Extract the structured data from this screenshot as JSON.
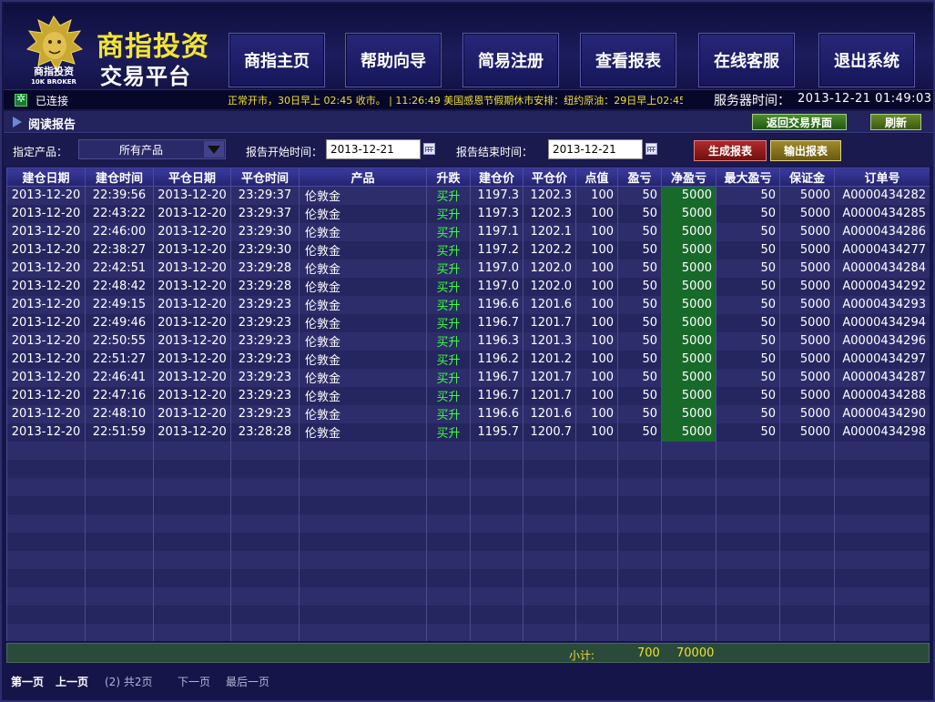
{
  "header": {
    "logo_text": "商指投资",
    "logo_sub": "10K BROKER",
    "brand_title": "商指投资",
    "brand_subtitle": "交易平台",
    "nav": [
      "商指主页",
      "帮助向导",
      "简易注册",
      "查看报表",
      "在线客服",
      "退出系统"
    ]
  },
  "status": {
    "connection": "已连接",
    "ticker": "正常开市，30日早上 02:45 收市。 | 11:26:49 美国感恩节假期休市安排：纽约原油：29日早上02:45收市，",
    "server_label": "服务器时间：",
    "server_time": "2013-12-21 01:49:03"
  },
  "section": {
    "title": "阅读报告",
    "back_label": "返回交易界面",
    "refresh_label": "刷新"
  },
  "filters": {
    "product_label": "指定产品：",
    "product_value": "所有产品",
    "start_label": "报告开始时间：",
    "start_value": "2013-12-21",
    "end_label": "报告结束时间：",
    "end_value": "2013-12-21",
    "generate_label": "生成报表",
    "export_label": "输出报表"
  },
  "table": {
    "columns": [
      "建仓日期",
      "建仓时间",
      "平仓日期",
      "平仓时间",
      "产品",
      "升跌",
      "建仓价",
      "平仓价",
      "点值",
      "盈亏",
      "净盈亏",
      "最大盈亏",
      "保证金",
      "订单号"
    ],
    "rows": [
      [
        "2013-12-20",
        "22:39:56",
        "2013-12-20",
        "23:29:37",
        "伦敦金",
        "买升",
        "1197.3",
        "1202.3",
        "100",
        "50",
        "5000",
        "50",
        "5000",
        "A0000434282"
      ],
      [
        "2013-12-20",
        "22:43:22",
        "2013-12-20",
        "23:29:37",
        "伦敦金",
        "买升",
        "1197.3",
        "1202.3",
        "100",
        "50",
        "5000",
        "50",
        "5000",
        "A0000434285"
      ],
      [
        "2013-12-20",
        "22:46:00",
        "2013-12-20",
        "23:29:30",
        "伦敦金",
        "买升",
        "1197.1",
        "1202.1",
        "100",
        "50",
        "5000",
        "50",
        "5000",
        "A0000434286"
      ],
      [
        "2013-12-20",
        "22:38:27",
        "2013-12-20",
        "23:29:30",
        "伦敦金",
        "买升",
        "1197.2",
        "1202.2",
        "100",
        "50",
        "5000",
        "50",
        "5000",
        "A0000434277"
      ],
      [
        "2013-12-20",
        "22:42:51",
        "2013-12-20",
        "23:29:28",
        "伦敦金",
        "买升",
        "1197.0",
        "1202.0",
        "100",
        "50",
        "5000",
        "50",
        "5000",
        "A0000434284"
      ],
      [
        "2013-12-20",
        "22:48:42",
        "2013-12-20",
        "23:29:28",
        "伦敦金",
        "买升",
        "1197.0",
        "1202.0",
        "100",
        "50",
        "5000",
        "50",
        "5000",
        "A0000434292"
      ],
      [
        "2013-12-20",
        "22:49:15",
        "2013-12-20",
        "23:29:23",
        "伦敦金",
        "买升",
        "1196.6",
        "1201.6",
        "100",
        "50",
        "5000",
        "50",
        "5000",
        "A0000434293"
      ],
      [
        "2013-12-20",
        "22:49:46",
        "2013-12-20",
        "23:29:23",
        "伦敦金",
        "买升",
        "1196.7",
        "1201.7",
        "100",
        "50",
        "5000",
        "50",
        "5000",
        "A0000434294"
      ],
      [
        "2013-12-20",
        "22:50:55",
        "2013-12-20",
        "23:29:23",
        "伦敦金",
        "买升",
        "1196.3",
        "1201.3",
        "100",
        "50",
        "5000",
        "50",
        "5000",
        "A0000434296"
      ],
      [
        "2013-12-20",
        "22:51:27",
        "2013-12-20",
        "23:29:23",
        "伦敦金",
        "买升",
        "1196.2",
        "1201.2",
        "100",
        "50",
        "5000",
        "50",
        "5000",
        "A0000434297"
      ],
      [
        "2013-12-20",
        "22:46:41",
        "2013-12-20",
        "23:29:23",
        "伦敦金",
        "买升",
        "1196.7",
        "1201.7",
        "100",
        "50",
        "5000",
        "50",
        "5000",
        "A0000434287"
      ],
      [
        "2013-12-20",
        "22:47:16",
        "2013-12-20",
        "23:29:23",
        "伦敦金",
        "买升",
        "1196.7",
        "1201.7",
        "100",
        "50",
        "5000",
        "50",
        "5000",
        "A0000434288"
      ],
      [
        "2013-12-20",
        "22:48:10",
        "2013-12-20",
        "23:29:23",
        "伦敦金",
        "买升",
        "1196.6",
        "1201.6",
        "100",
        "50",
        "5000",
        "50",
        "5000",
        "A0000434290"
      ],
      [
        "2013-12-20",
        "22:51:59",
        "2013-12-20",
        "23:28:28",
        "伦敦金",
        "买升",
        "1195.7",
        "1200.7",
        "100",
        "50",
        "5000",
        "50",
        "5000",
        "A0000434298"
      ]
    ]
  },
  "summary": {
    "label": "小计:",
    "profit_total": "700",
    "net_total": "70000"
  },
  "pager": {
    "first": "第一页",
    "prev": "上一页",
    "info": "(2) 共2页",
    "next": "下一页",
    "last": "最后一页"
  },
  "colors": {
    "ticker": "#f0e030",
    "direction_up": "#3cff3c",
    "net_cell": "#186a2a",
    "brand_gold": "#f2e530"
  }
}
